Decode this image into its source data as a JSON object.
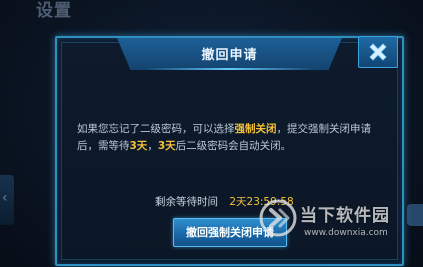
{
  "background": {
    "title": "设置"
  },
  "dialog": {
    "title": "撤回申请",
    "close_icon": "close-x-icon",
    "message": {
      "part1": "如果您忘记了二级密码，可以选择",
      "highlight1": "强制关闭",
      "part2": "，提交强制关闭申请后，需等待",
      "highlight2": "3天",
      "part3": "，",
      "highlight3": "3天",
      "part4": "后二级密码会自动关闭。"
    },
    "timer_label": "剩余等待时间",
    "timer_value": "2天23:59:58",
    "action_button": "撤回强制关闭申请"
  },
  "watermark": {
    "name": "当下软件园",
    "url": "www.downxia.com"
  },
  "colors": {
    "accent": "#2e8fc0",
    "highlight": "#f3c13a",
    "dialog_bg": "#0e1b2c",
    "text": "#b9c8d8"
  }
}
